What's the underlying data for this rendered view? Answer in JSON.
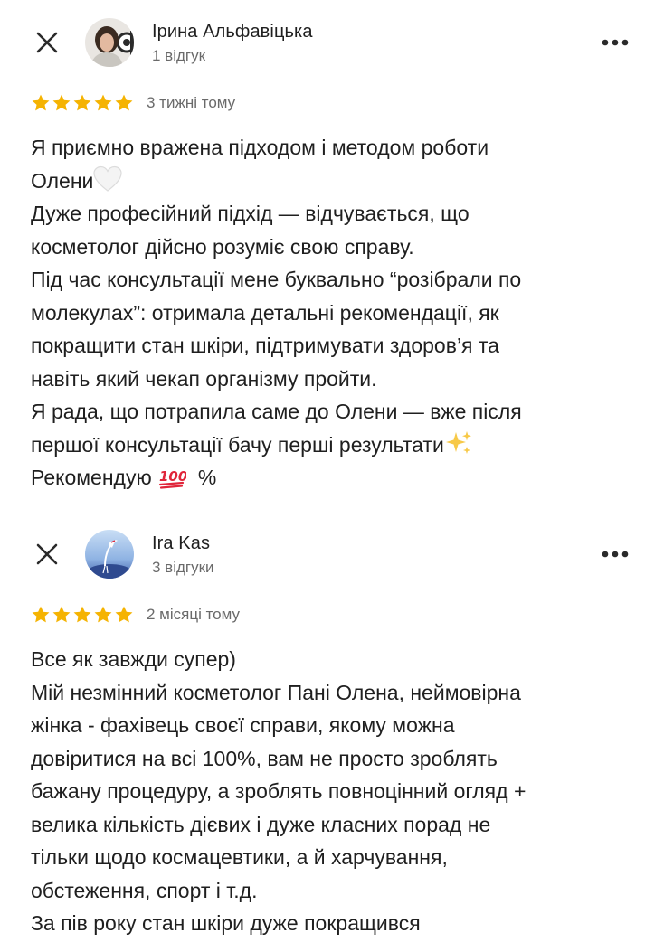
{
  "reviews": [
    {
      "author": "Ірина Альфавіцька",
      "review_count": "1 відгук",
      "rating": 5,
      "time": "3 тижні тому",
      "text_lines": [
        "Я приємно вражена підходом і методом роботи",
        "Олени",
        "Дуже професійний підхід — відчувається, що",
        "косметолог дійсно розуміє свою справу.",
        "Під час консультації мене буквально “розібрали по",
        "молекулах”: отримала детальні рекомендації, як",
        "покращити стан шкіри, підтримувати здоров’я та",
        "навіть який чекап організму пройти.",
        "Я рада, що потрапила саме до Олени — вже після",
        "першої консультації бачу перші результати",
        "Рекомендую"
      ],
      "text_tail_after_emoji": "%",
      "emojis": [
        "white-heart-emoji",
        "sparkles-emoji",
        "hundred-points-emoji"
      ]
    },
    {
      "author": "Ira Kas",
      "review_count": "3 відгуки",
      "rating": 5,
      "time": "2 місяці тому",
      "text_lines": [
        "Все як завжди супер)",
        "Мій незмінний косметолог Пані Олена, неймовірна",
        "жінка - фахівець своєї справи, якому можна",
        "довіритися на всі 100%, вам не просто зроблять",
        "бажану процедуру, а зроблять повноцінний огляд +",
        "велика кількість дієвих і дуже класних порад не",
        "тільки щодо космацевтики, а й харчування,",
        "обстеження, спорт і т.д.",
        "За пів року стан шкіри дуже покращився"
      ]
    }
  ],
  "colors": {
    "star": "#f5b301",
    "text": "#1f1f1f",
    "secondary": "#6a6a6a"
  },
  "icons": {
    "close": "close-icon",
    "more": "more-horiz-icon",
    "star": "star-icon"
  }
}
